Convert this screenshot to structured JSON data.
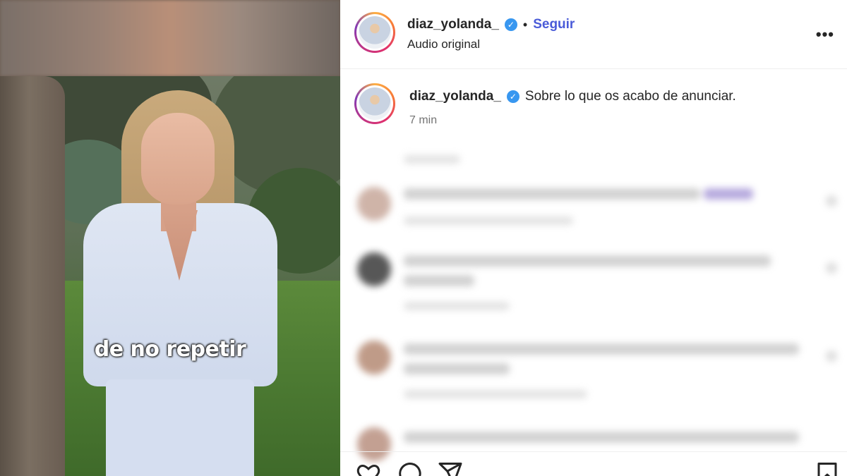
{
  "video": {
    "caption": "de no repetir"
  },
  "header": {
    "username": "diaz_yolanda_",
    "verified_icon": "verified-badge-icon",
    "separator": "•",
    "follow_label": "Seguir",
    "subtitle": "Audio original",
    "more_icon": "more-options-icon",
    "more_glyph": "•••"
  },
  "post": {
    "username": "diaz_yolanda_",
    "caption": "Sobre lo que os acabo de anunciar.",
    "time": "7 min"
  },
  "colors": {
    "follow": "#4a5bd8",
    "verified": "#3897f0",
    "text": "#262626",
    "muted": "#737373"
  },
  "actions": {
    "icons": [
      "heart-icon",
      "comment-icon",
      "share-icon",
      "bookmark-icon"
    ]
  }
}
